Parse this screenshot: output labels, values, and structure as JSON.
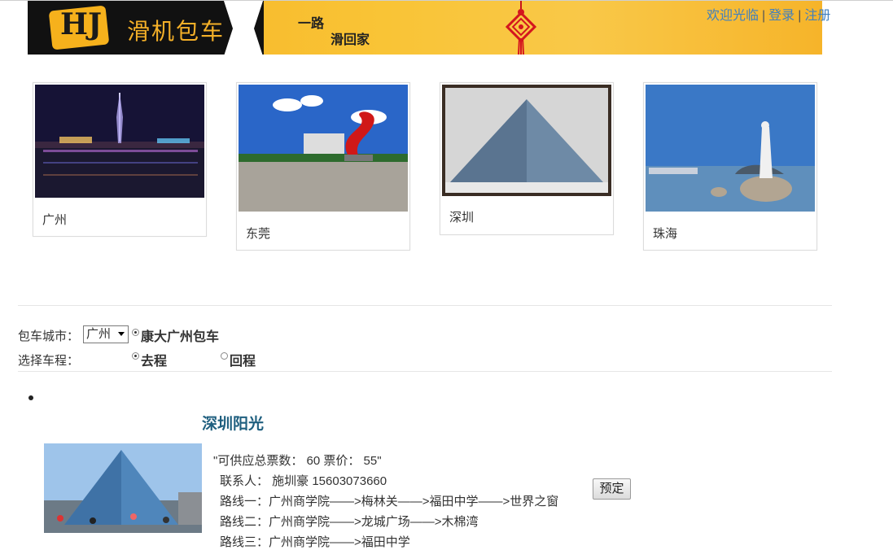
{
  "banner": {
    "logo_mark": "HJ",
    "brand_name": "滑机包车",
    "slogan_line1": "一路",
    "slogan_line2": "滑回家"
  },
  "userbar": {
    "welcome": "欢迎光临",
    "login": "登录",
    "register": "注册",
    "separator": "|"
  },
  "cities": [
    {
      "name": "广州"
    },
    {
      "name": "东莞"
    },
    {
      "name": "深圳"
    },
    {
      "name": "珠海"
    }
  ],
  "form": {
    "city_label": "包车城市：",
    "city_selected": "广州",
    "company_name": "康大广州包车",
    "trip_label": "选择车程：",
    "trip_go": "去程",
    "trip_return": "回程"
  },
  "route": {
    "title": "深圳阳光",
    "tickets_line": "\"可供应总票数： 60      票价： 55\"",
    "contact_line": "联系人： 施圳豪 15603073660",
    "route1": "路线一：广州商学院——>梅林关——>福田中学——>世界之窗",
    "route2": "路线二：广州商学院——>龙城广场——>木棉湾",
    "route3": "路线三：广州商学院——>福田中学",
    "book_label": "预定"
  },
  "colors": {
    "link": "#3f7fbf",
    "route_title": "#1f5f7f",
    "banner_gold": "#f9c436"
  }
}
